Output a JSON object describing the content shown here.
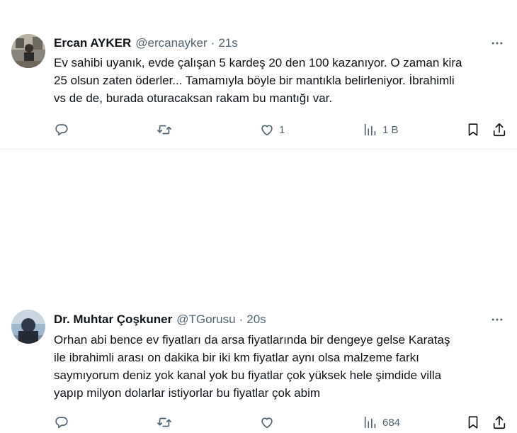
{
  "tweets": [
    {
      "author_name": "Ercan AYKER",
      "handle": "@ercanayker",
      "separator": "·",
      "time": "21s",
      "text_lines": [
        "Ev sahibi uyanık, evde çalışan 5 kardeş 20 den 100 kazanıyor. O zaman kira",
        "25 olsun zaten öderler... Tamamıyla böyle bir mantıkla belirleniyor. İbrahimli",
        "vs de de, burada oturacaksan rakam bu mantığı var."
      ],
      "replies": "",
      "reposts": "",
      "likes": "1",
      "views": "1 B"
    },
    {
      "author_name": "Dr. Muhtar Çoşkuner",
      "handle": "@TGorusu",
      "separator": "·",
      "time": "20s",
      "text_lines": [
        "Orhan abi bence ev fiyatları da arsa fiyatlarında bir dengeye gelse Karataş",
        "ile ibrahimli arası on dakika bir iki km fiyatlar aynı olsa malzeme farkı",
        "saymıyorum deniz yok kanal yok bu fiyatlar çok yüksek hele şimdide villa",
        "yapıp milyon dolarlar istiyorlar bu fiyatlar çok abim"
      ],
      "replies": "",
      "reposts": "",
      "likes": "",
      "views": "684"
    }
  ],
  "icons": {
    "more": "more-icon",
    "reply": "reply-icon",
    "repost": "repost-icon",
    "like": "heart-icon",
    "views": "views-icon",
    "bookmark": "bookmark-icon",
    "share": "share-icon"
  },
  "colors": {
    "text": "#0f1419",
    "secondary": "#536471",
    "divider": "#eff3f4"
  }
}
